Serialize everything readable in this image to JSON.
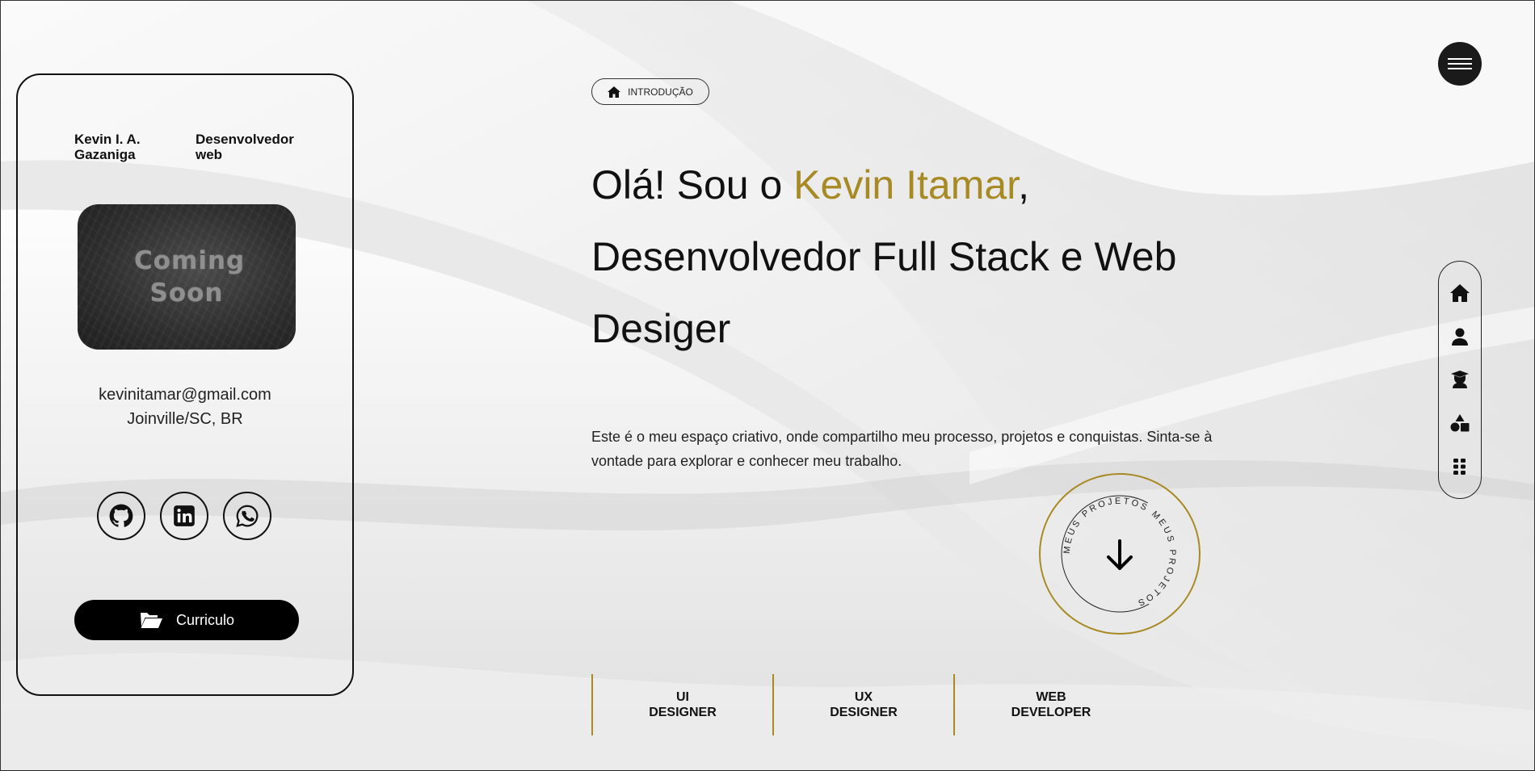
{
  "profile": {
    "name": "Kevin I. A. Gazaniga",
    "role": "Desenvolvedor web",
    "photo_text": "Coming Soon",
    "email": "kevinitamar@gmail.com",
    "location": "Joinville/SC, BR",
    "socials": [
      {
        "icon": "github-icon"
      },
      {
        "icon": "linkedin-icon"
      },
      {
        "icon": "whatsapp-icon"
      }
    ],
    "cv_label": "Curriculo"
  },
  "intro": {
    "badge_label": "INTRODUÇÃO",
    "headline_prefix": "Olá! Sou o ",
    "headline_name": "Kevin Itamar",
    "headline_suffix": ",",
    "headline_line2": "Desenvolvedor Full Stack e Web",
    "headline_line3": "Desiger",
    "description": "Este é o meu espaço criativo, onde compartilho meu processo, projetos e conquistas. Sinta-se à vontade para explorar e conhecer meu trabalho.",
    "circle_text": "MEUS PROJETOS MEUS PROJETOS"
  },
  "skills": [
    {
      "line1": "UI",
      "line2": "DESIGNER"
    },
    {
      "line1": "UX",
      "line2": "DESIGNER"
    },
    {
      "line1": "WEB",
      "line2": "DEVELOPER"
    }
  ],
  "nav": {
    "items": [
      {
        "icon": "home-icon"
      },
      {
        "icon": "user-icon"
      },
      {
        "icon": "graduation-icon"
      },
      {
        "icon": "shapes-icon"
      },
      {
        "icon": "grid-icon"
      }
    ]
  },
  "colors": {
    "accent": "#a88a24",
    "dark": "#000000",
    "background": "#f2f2f2"
  }
}
